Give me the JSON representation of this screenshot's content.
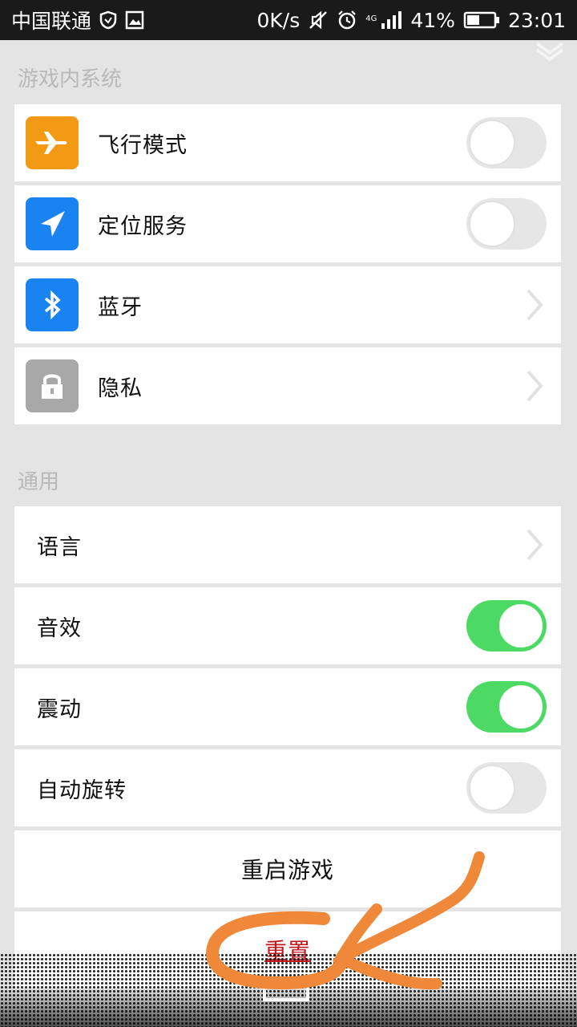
{
  "status_bar": {
    "carrier": "中国联通",
    "speed": "0K/s",
    "network": "4G",
    "battery": "41%",
    "time": "23:01"
  },
  "section_game_system": {
    "title": "游戏内系统",
    "items": [
      {
        "label": "飞行模式",
        "icon": "airplane-icon",
        "icon_color": "#f39a14",
        "control": "toggle",
        "on": false
      },
      {
        "label": "定位服务",
        "icon": "location-arrow-icon",
        "icon_color": "#1a83f2",
        "control": "toggle",
        "on": false
      },
      {
        "label": "蓝牙",
        "icon": "bluetooth-icon",
        "icon_color": "#1a83f2",
        "control": "chevron"
      },
      {
        "label": "隐私",
        "icon": "lock-icon",
        "icon_color": "#a8a8a8",
        "control": "chevron"
      }
    ]
  },
  "section_general": {
    "title": "通用",
    "items": [
      {
        "label": "语言",
        "control": "chevron"
      },
      {
        "label": "音效",
        "control": "toggle",
        "on": true
      },
      {
        "label": "震动",
        "control": "toggle",
        "on": true
      },
      {
        "label": "自动旋转",
        "control": "toggle",
        "on": false
      }
    ],
    "restart_label": "重启游戏",
    "reset_label": "重置"
  },
  "colors": {
    "toggle_on": "#4cd964",
    "toggle_off": "#e6e6e6",
    "reset_text": "#c0161c",
    "annotation_scribble": "#f0883a"
  }
}
